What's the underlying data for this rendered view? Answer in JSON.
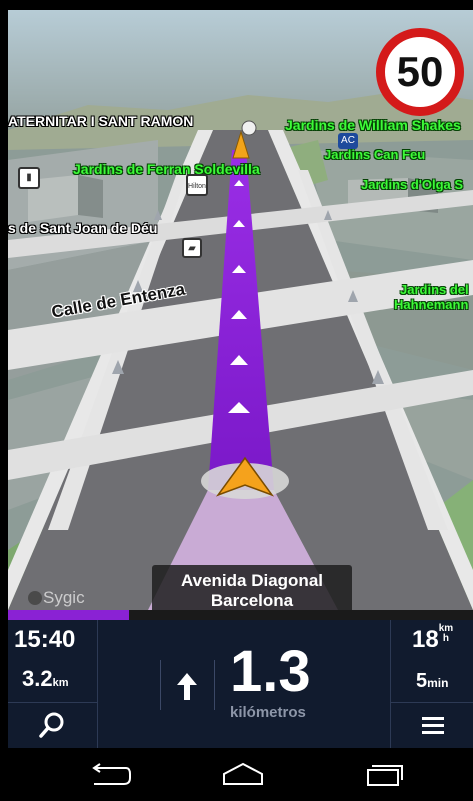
{
  "map": {
    "labels": {
      "fraternitat": "ATERNITAR I SANT RAMON",
      "jardins_william": "Jardins de William Shakes",
      "jardins_ferran": "Jardins de Ferran Soldevilla",
      "jardins_can_feu": "Jardins Can Feu",
      "jardins_olga": "Jardins d'Olga S",
      "sant_joan": "s de Sant Joan de Déu",
      "jardins_del": "Jardins del",
      "hahnemann": "Hahnemann",
      "calle_entenza": "Calle de Entenza",
      "ac_badge": "AC",
      "hilton": "Hilton"
    },
    "speed_limit": "50",
    "current_street": {
      "line1": "Avenida Diagonal",
      "line2": "Barcelona"
    },
    "brand": "Sygic",
    "route_color": "#8a22d4"
  },
  "route_progress": 0.26,
  "panel": {
    "time": "15:40",
    "remaining_distance": "3.2",
    "remaining_distance_unit": "km",
    "speed": "18",
    "speed_unit_top": "km",
    "speed_unit_bottom": "h",
    "duration": "5",
    "duration_unit": "min",
    "next_turn_distance": "1.3",
    "next_turn_unit": "kilómetros",
    "direction_icon": "straight-arrow-icon",
    "search_icon": "search-icon",
    "menu_icon": "menu-icon"
  },
  "nav_bar": {
    "back": "back-icon",
    "home": "home-icon",
    "recents": "recents-icon"
  }
}
